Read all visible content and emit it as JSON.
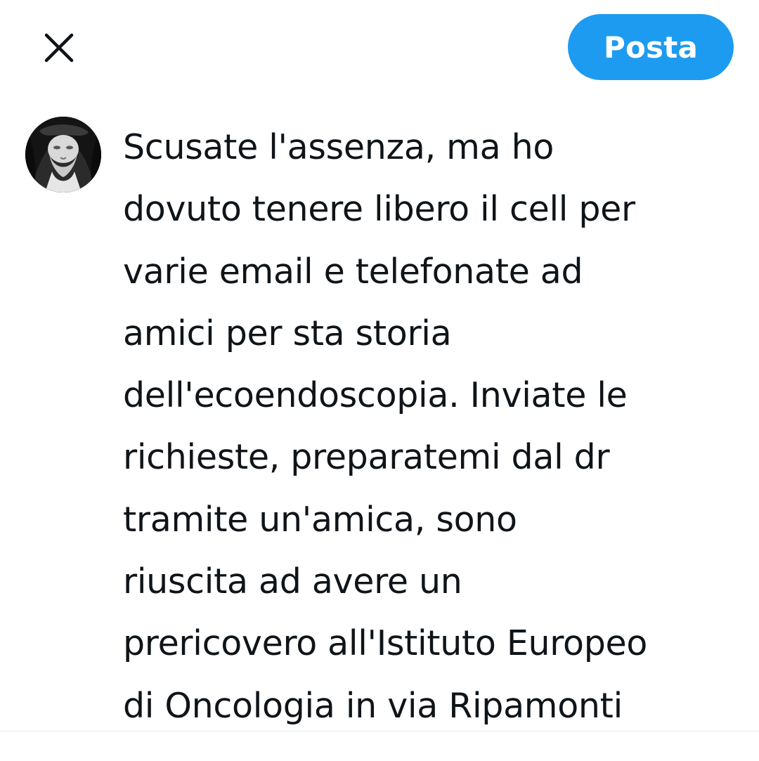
{
  "header": {
    "close_icon": "close-icon",
    "post_label": "Posta",
    "post_button_color": "#1d9bf0"
  },
  "composer": {
    "avatar_icon": "user-avatar",
    "text": "Scusate l'assenza, ma ho\ndovuto tenere libero il cell per\nvarie email e telefonate ad\namici per sta storia\ndell'ecoendoscopia. Inviate le\nrichieste, preparatemi dal dr\ntramite un'amica, sono\nriuscita ad avere un\nprericovero all'Istituto Europeo\ndi Oncologia in via Ripamonti"
  }
}
